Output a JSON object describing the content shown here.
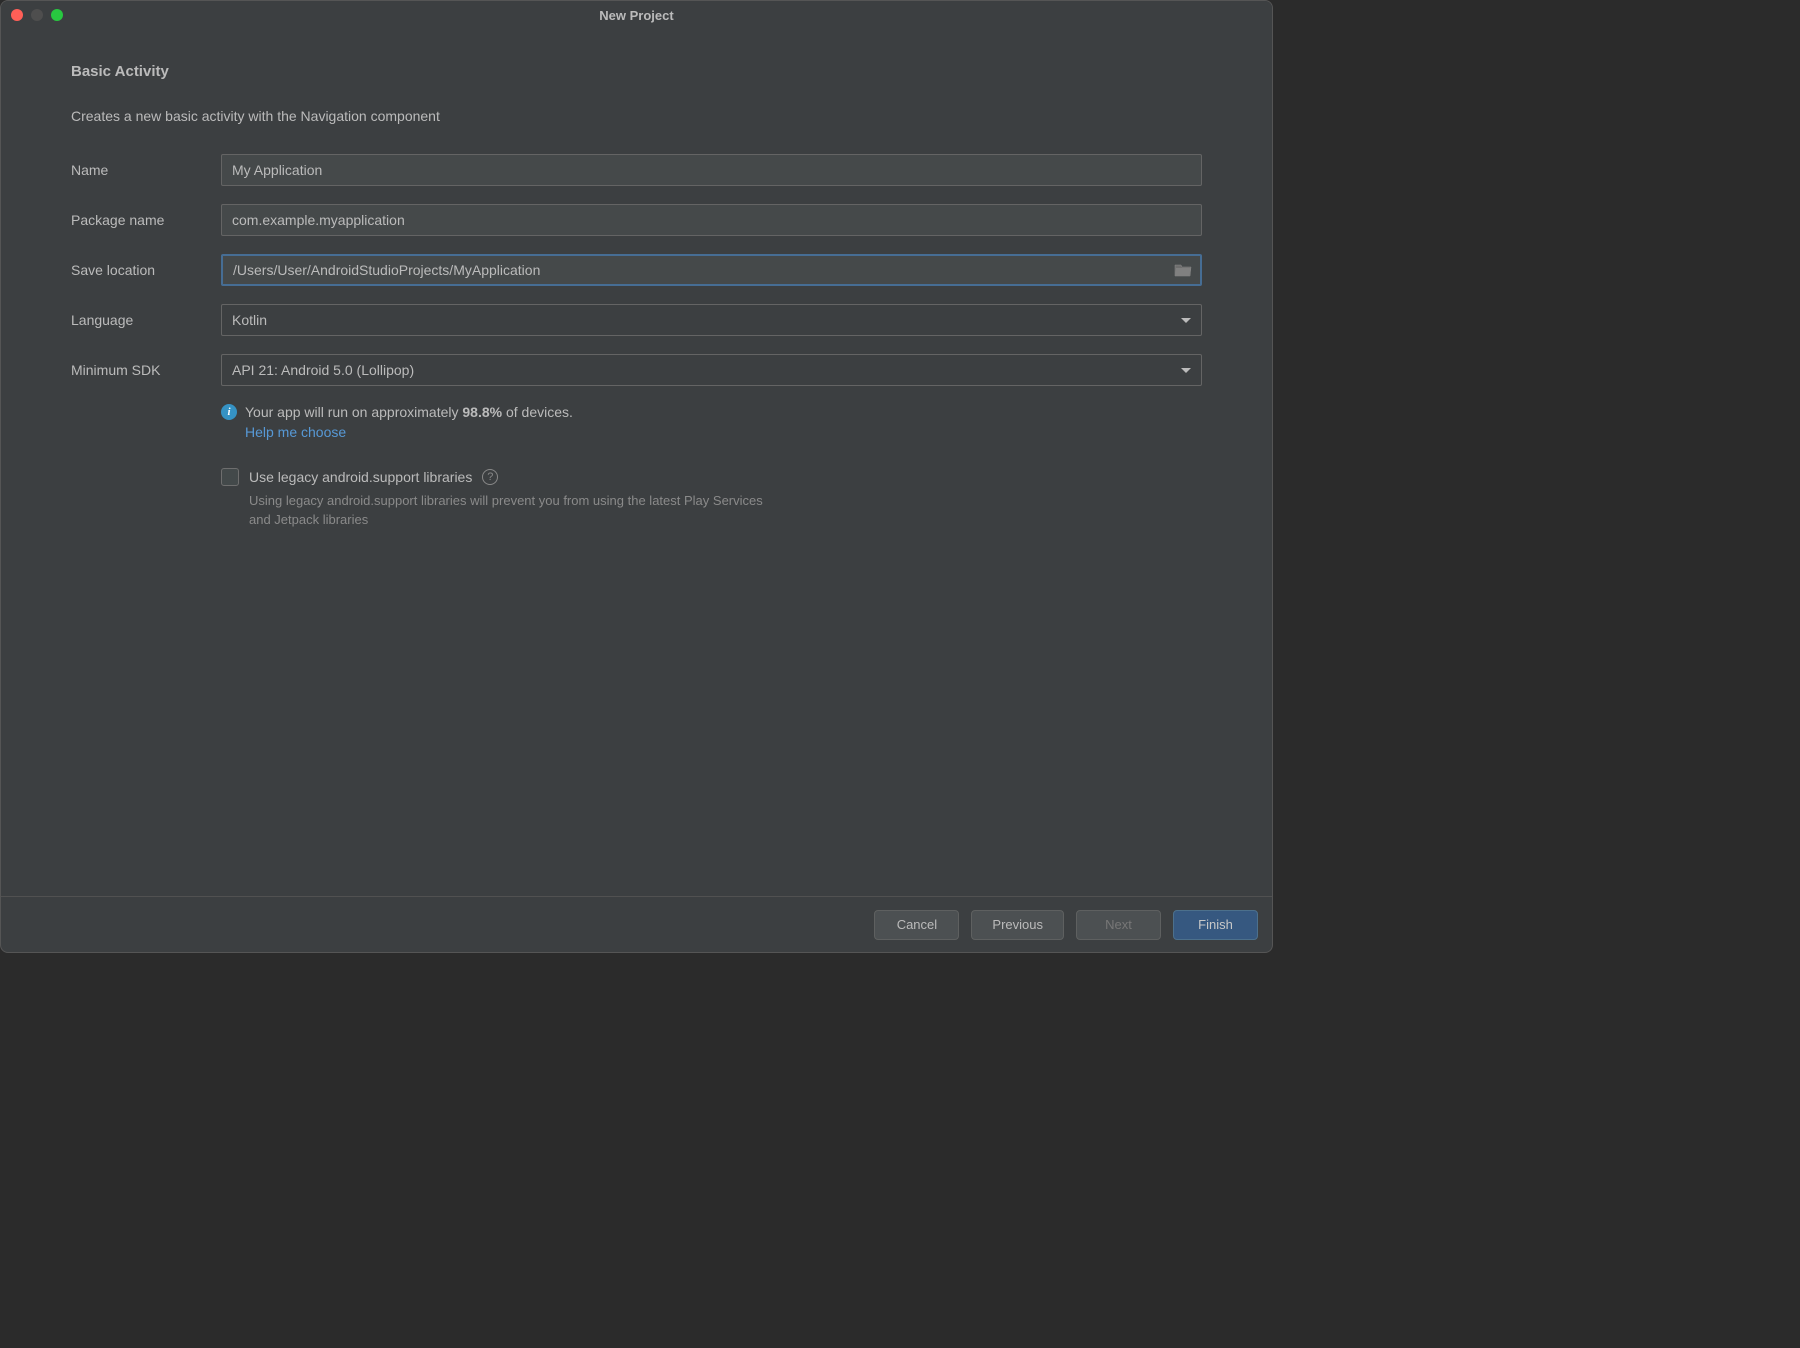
{
  "window": {
    "title": "New Project"
  },
  "page": {
    "heading": "Basic Activity",
    "description": "Creates a new basic activity with the Navigation component"
  },
  "form": {
    "name": {
      "label": "Name",
      "value": "My Application"
    },
    "package": {
      "label": "Package name",
      "value": "com.example.myapplication"
    },
    "location": {
      "label": "Save location",
      "value": "/Users/User/AndroidStudioProjects/MyApplication"
    },
    "language": {
      "label": "Language",
      "value": "Kotlin"
    },
    "minsdk": {
      "label": "Minimum SDK",
      "value": "API 21: Android 5.0 (Lollipop)"
    }
  },
  "info": {
    "prefix": "Your app will run on approximately ",
    "percent": "98.8%",
    "suffix": " of devices.",
    "help_link": "Help me choose"
  },
  "legacy": {
    "label": "Use legacy android.support libraries",
    "desc": "Using legacy android.support libraries will prevent you from using the latest Play Services and Jetpack libraries"
  },
  "buttons": {
    "cancel": "Cancel",
    "previous": "Previous",
    "next": "Next",
    "finish": "Finish"
  }
}
